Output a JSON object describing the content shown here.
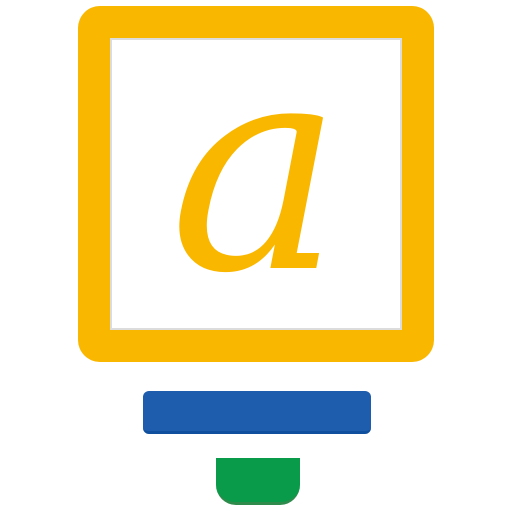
{
  "logo": {
    "glyph": "a",
    "colors": {
      "frame": "#F9B700",
      "glyph": "#F9B700",
      "bar": "#1E5CAD",
      "foot": "#0A9B4A",
      "background": "#FFFFFF"
    },
    "icon_name": "lightbulb-at-sign-icon"
  }
}
